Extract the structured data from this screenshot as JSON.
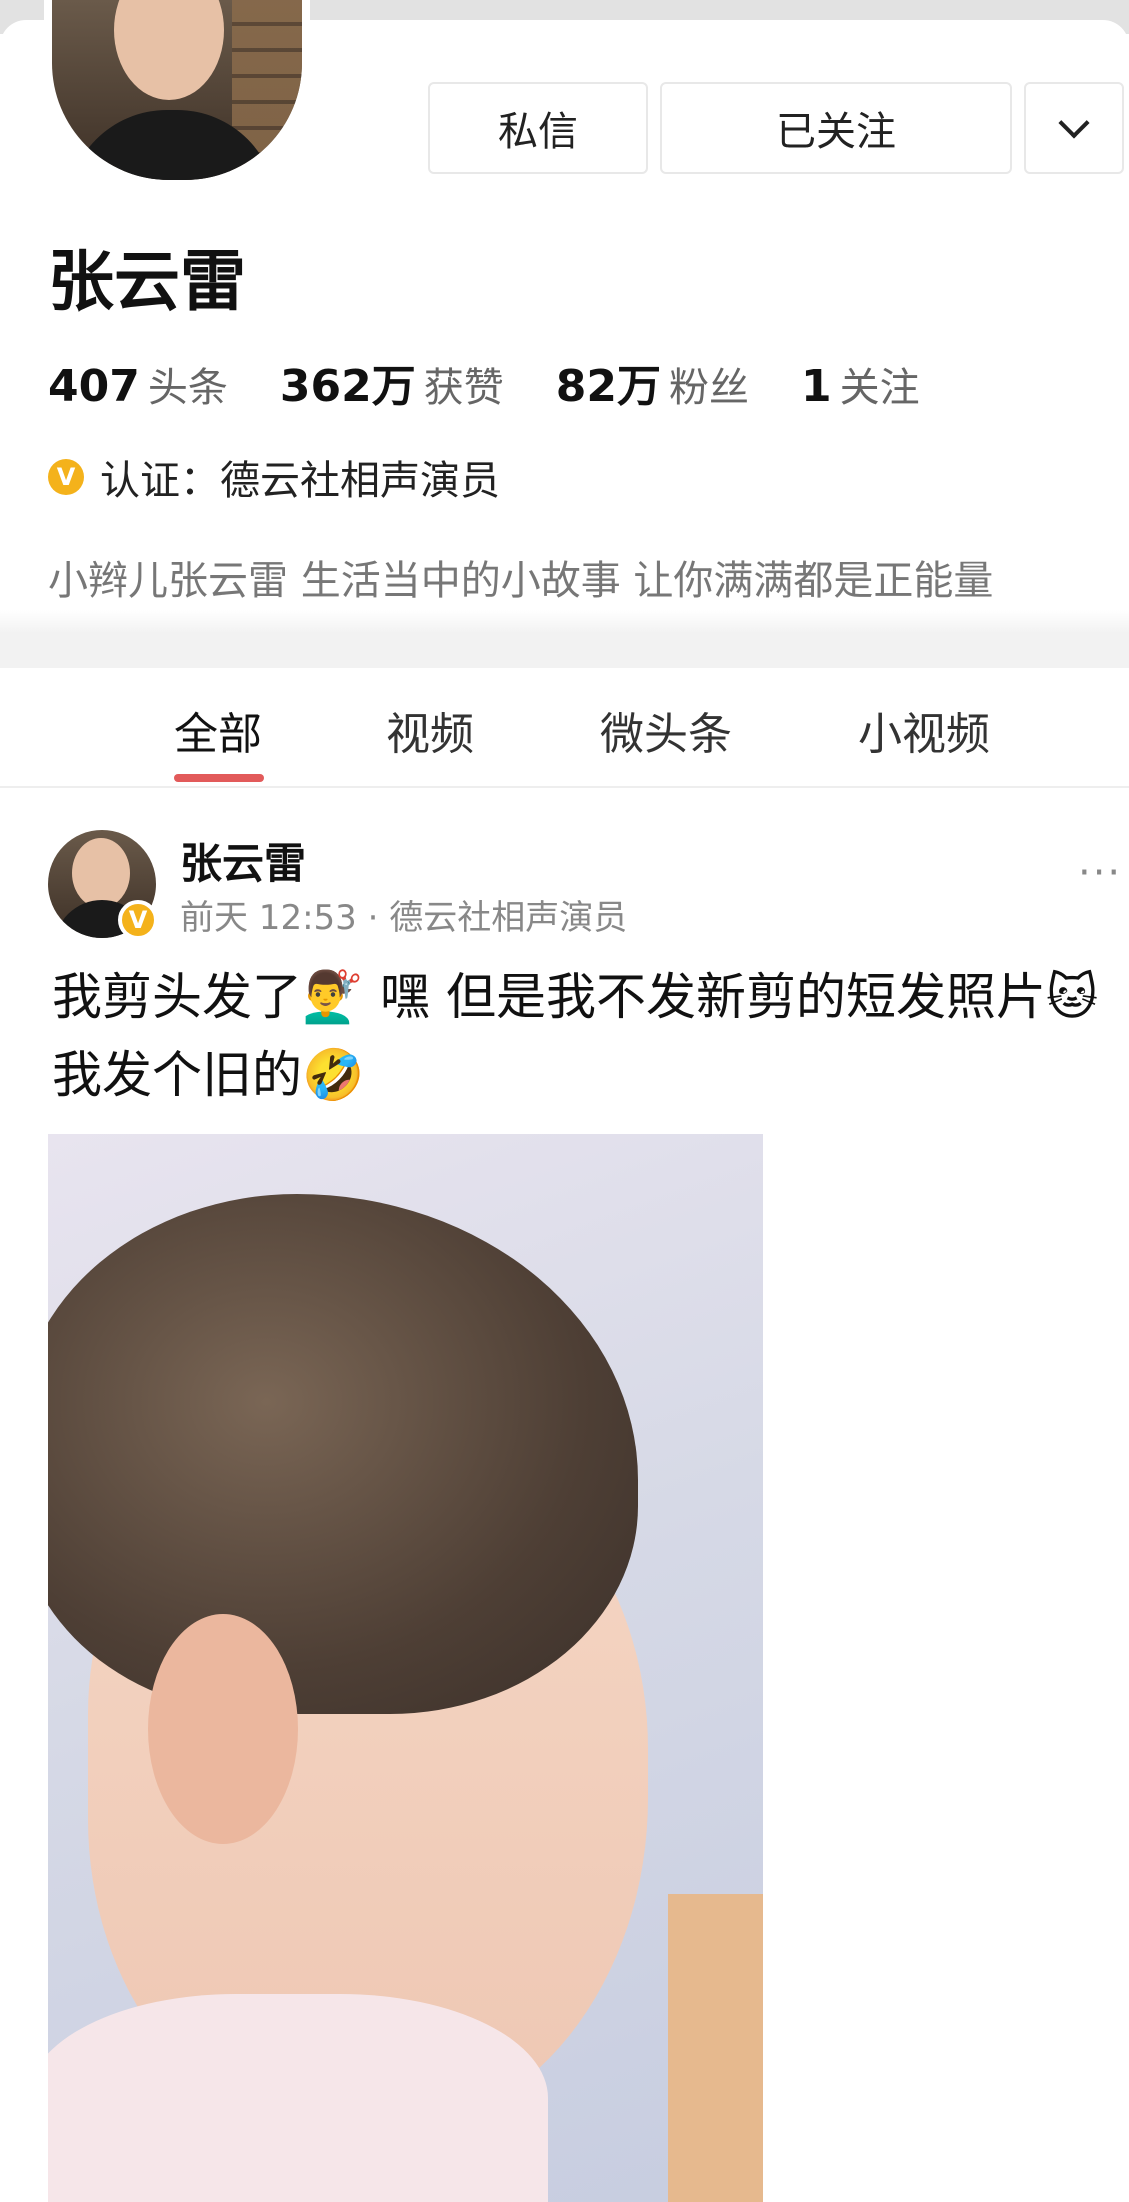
{
  "profile": {
    "name": "张云雷",
    "buttons": {
      "message": "私信",
      "follow": "已关注"
    },
    "stats": [
      {
        "num": "407",
        "label": "头条"
      },
      {
        "num": "362万",
        "label": "获赞"
      },
      {
        "num": "82万",
        "label": "粉丝"
      },
      {
        "num": "1",
        "label": "关注"
      }
    ],
    "verify_badge": "V",
    "verify_label": "认证：德云社相声演员",
    "bio": "小辫儿张云雷 生活当中的小故事 让你满满都是正能量"
  },
  "tabs": [
    "全部",
    "视频",
    "微头条",
    "小视频"
  ],
  "post": {
    "author": "张云雷",
    "badge": "V",
    "meta": "前天 12:53 · 德云社相声演员",
    "more": "···",
    "text": "我剪头发了💇‍♂️ 嘿 但是我不发新剪的短发照片🐱 我发个旧的🤣"
  }
}
